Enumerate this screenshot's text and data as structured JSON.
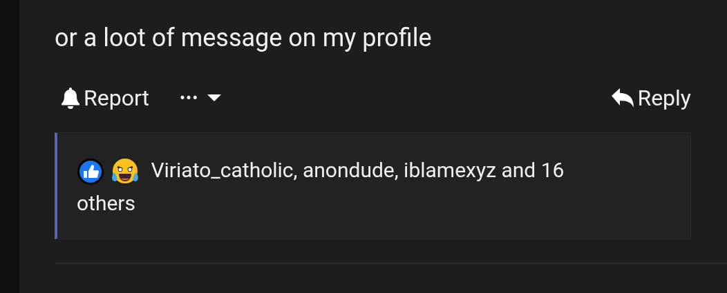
{
  "post": {
    "message": "or a loot of message on my profile"
  },
  "actions": [
    {
      "kind": "report",
      "label": "Report"
    },
    {
      "kind": "more",
      "label": "•••"
    },
    {
      "kind": "reply",
      "label": "Reply"
    }
  ],
  "reactions": {
    "icons": [
      {
        "kind": "like"
      },
      {
        "kind": "haha"
      }
    ],
    "summary_lines": [
      "Viriato_catholic, anondude, iblamexyz and 16",
      "others"
    ]
  }
}
